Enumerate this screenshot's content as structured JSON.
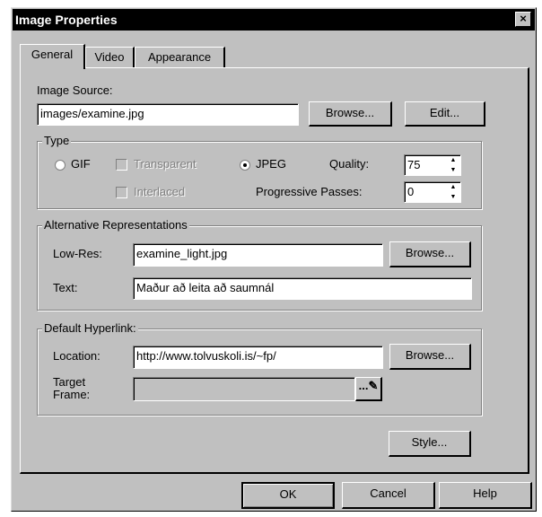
{
  "window": {
    "title": "Image Properties",
    "close_glyph": "×"
  },
  "tabs": [
    {
      "label": "General",
      "active": true
    },
    {
      "label": "Video",
      "active": false
    },
    {
      "label": "Appearance",
      "active": false
    }
  ],
  "image_source": {
    "label": "Image Source:",
    "value": "images/examine.jpg",
    "browse_label": "Browse...",
    "edit_label": "Edit..."
  },
  "type_group": {
    "title": "Type",
    "gif_label": "GIF",
    "transparent_label": "Transparent",
    "jpeg_label": "JPEG",
    "quality_label": "Quality:",
    "quality_value": "75",
    "interlaced_label": "Interlaced",
    "progressive_label": "Progressive Passes:",
    "progressive_value": "0",
    "selected": "JPEG"
  },
  "alt_group": {
    "title": "Alternative Representations",
    "lowres_label": "Low-Res:",
    "lowres_value": "examine_light.jpg",
    "browse_label": "Browse...",
    "text_label": "Text:",
    "text_value": "Maður að leita að saumnál"
  },
  "link_group": {
    "title": "Default Hyperlink:",
    "location_label": "Location:",
    "location_value": "http://www.tolvuskoli.is/~fp/",
    "browse_label": "Browse...",
    "target_label_1": "Target",
    "target_label_2": "Frame:",
    "target_value": "",
    "dots_label": "...",
    "pencil_glyph": "✎"
  },
  "style_button": "Style...",
  "footer": {
    "ok": "OK",
    "cancel": "Cancel",
    "help": "Help"
  }
}
